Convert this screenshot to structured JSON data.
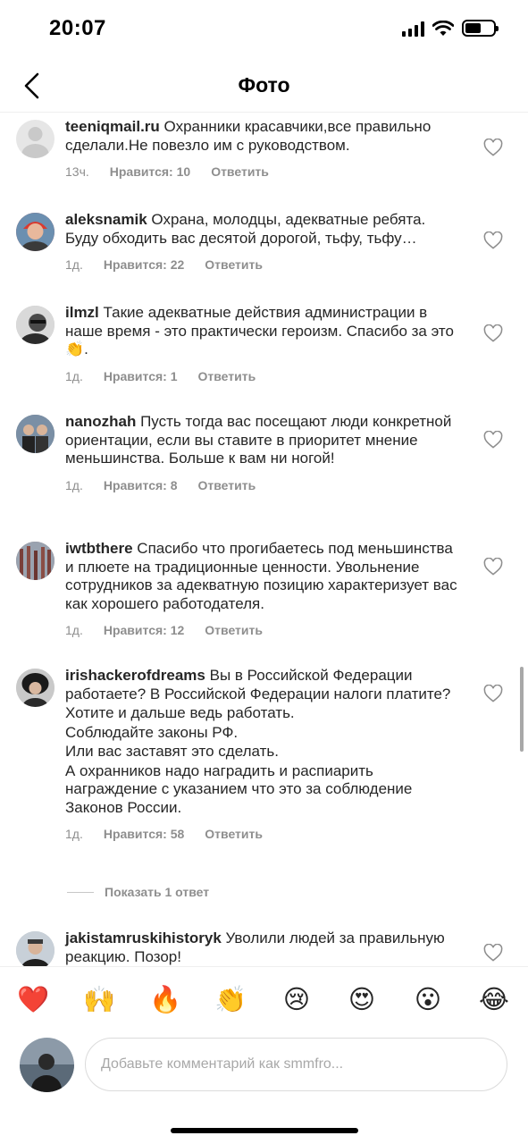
{
  "status_bar": {
    "time": "20:07"
  },
  "nav": {
    "title": "Фото"
  },
  "comments": [
    {
      "username": "teeniqmail.ru",
      "text": "Охранники красавчики,все правильно сделали.Не повезло им с руководством.",
      "time": "13ч.",
      "likes": "Нравится: 10",
      "reply": "Ответить"
    },
    {
      "username": "aleksnamik",
      "text": "Охрана, молодцы, адекватные ребята. Буду обходить вас десятой дорогой, тьфу, тьфу…",
      "time": "1д.",
      "likes": "Нравится: 22",
      "reply": "Ответить"
    },
    {
      "username": "ilmzl",
      "text": "Такие адекватные действия администрации в наше время - это практически героизм. Спасибо за это 👏.",
      "time": "1д.",
      "likes": "Нравится: 1",
      "reply": "Ответить"
    },
    {
      "username": "nanozhah",
      "text": "Пусть тогда вас посещают люди конкретной ориентации, если вы ставите в приоритет мнение меньшинства. Больше к вам ни ногой!",
      "time": "1д.",
      "likes": "Нравится: 8",
      "reply": "Ответить"
    },
    {
      "username": "iwtbthere",
      "text": "Спасибо что прогибаетесь под меньшинства и плюете на традиционные ценности. Увольнение сотрудников за адекватную позицию характеризует вас как хорошего работодателя.",
      "time": "1д.",
      "likes": "Нравится: 12",
      "reply": "Ответить"
    },
    {
      "username": "irishackerofdreams",
      "text": "Вы в Российской Федерации работаете? В Российской Федерации налоги платите?",
      "extra": [
        "Хотите и дальше ведь работать.",
        "Соблюдайте законы РФ.",
        "Или вас заставят это сделать.",
        "А охранников надо наградить и распиарить награждение с указанием что это за соблюдение Законов России."
      ],
      "time": "1д.",
      "likes": "Нравится: 58",
      "reply": "Ответить"
    },
    {
      "username": "jakistamruskihistoryk",
      "text": "Уволили людей за правильную реакцию. Позор!"
    }
  ],
  "show_replies": "Показать 1 ответ",
  "emojis": [
    "❤️",
    "🙌",
    "🔥",
    "👏",
    "😢",
    "😍",
    "😮",
    "😂"
  ],
  "composer": {
    "placeholder": "Добавьте комментарий как smmfro..."
  },
  "colors": {
    "meta": "#8e8e8e",
    "text": "#262626",
    "border": "#dbdbdb"
  }
}
